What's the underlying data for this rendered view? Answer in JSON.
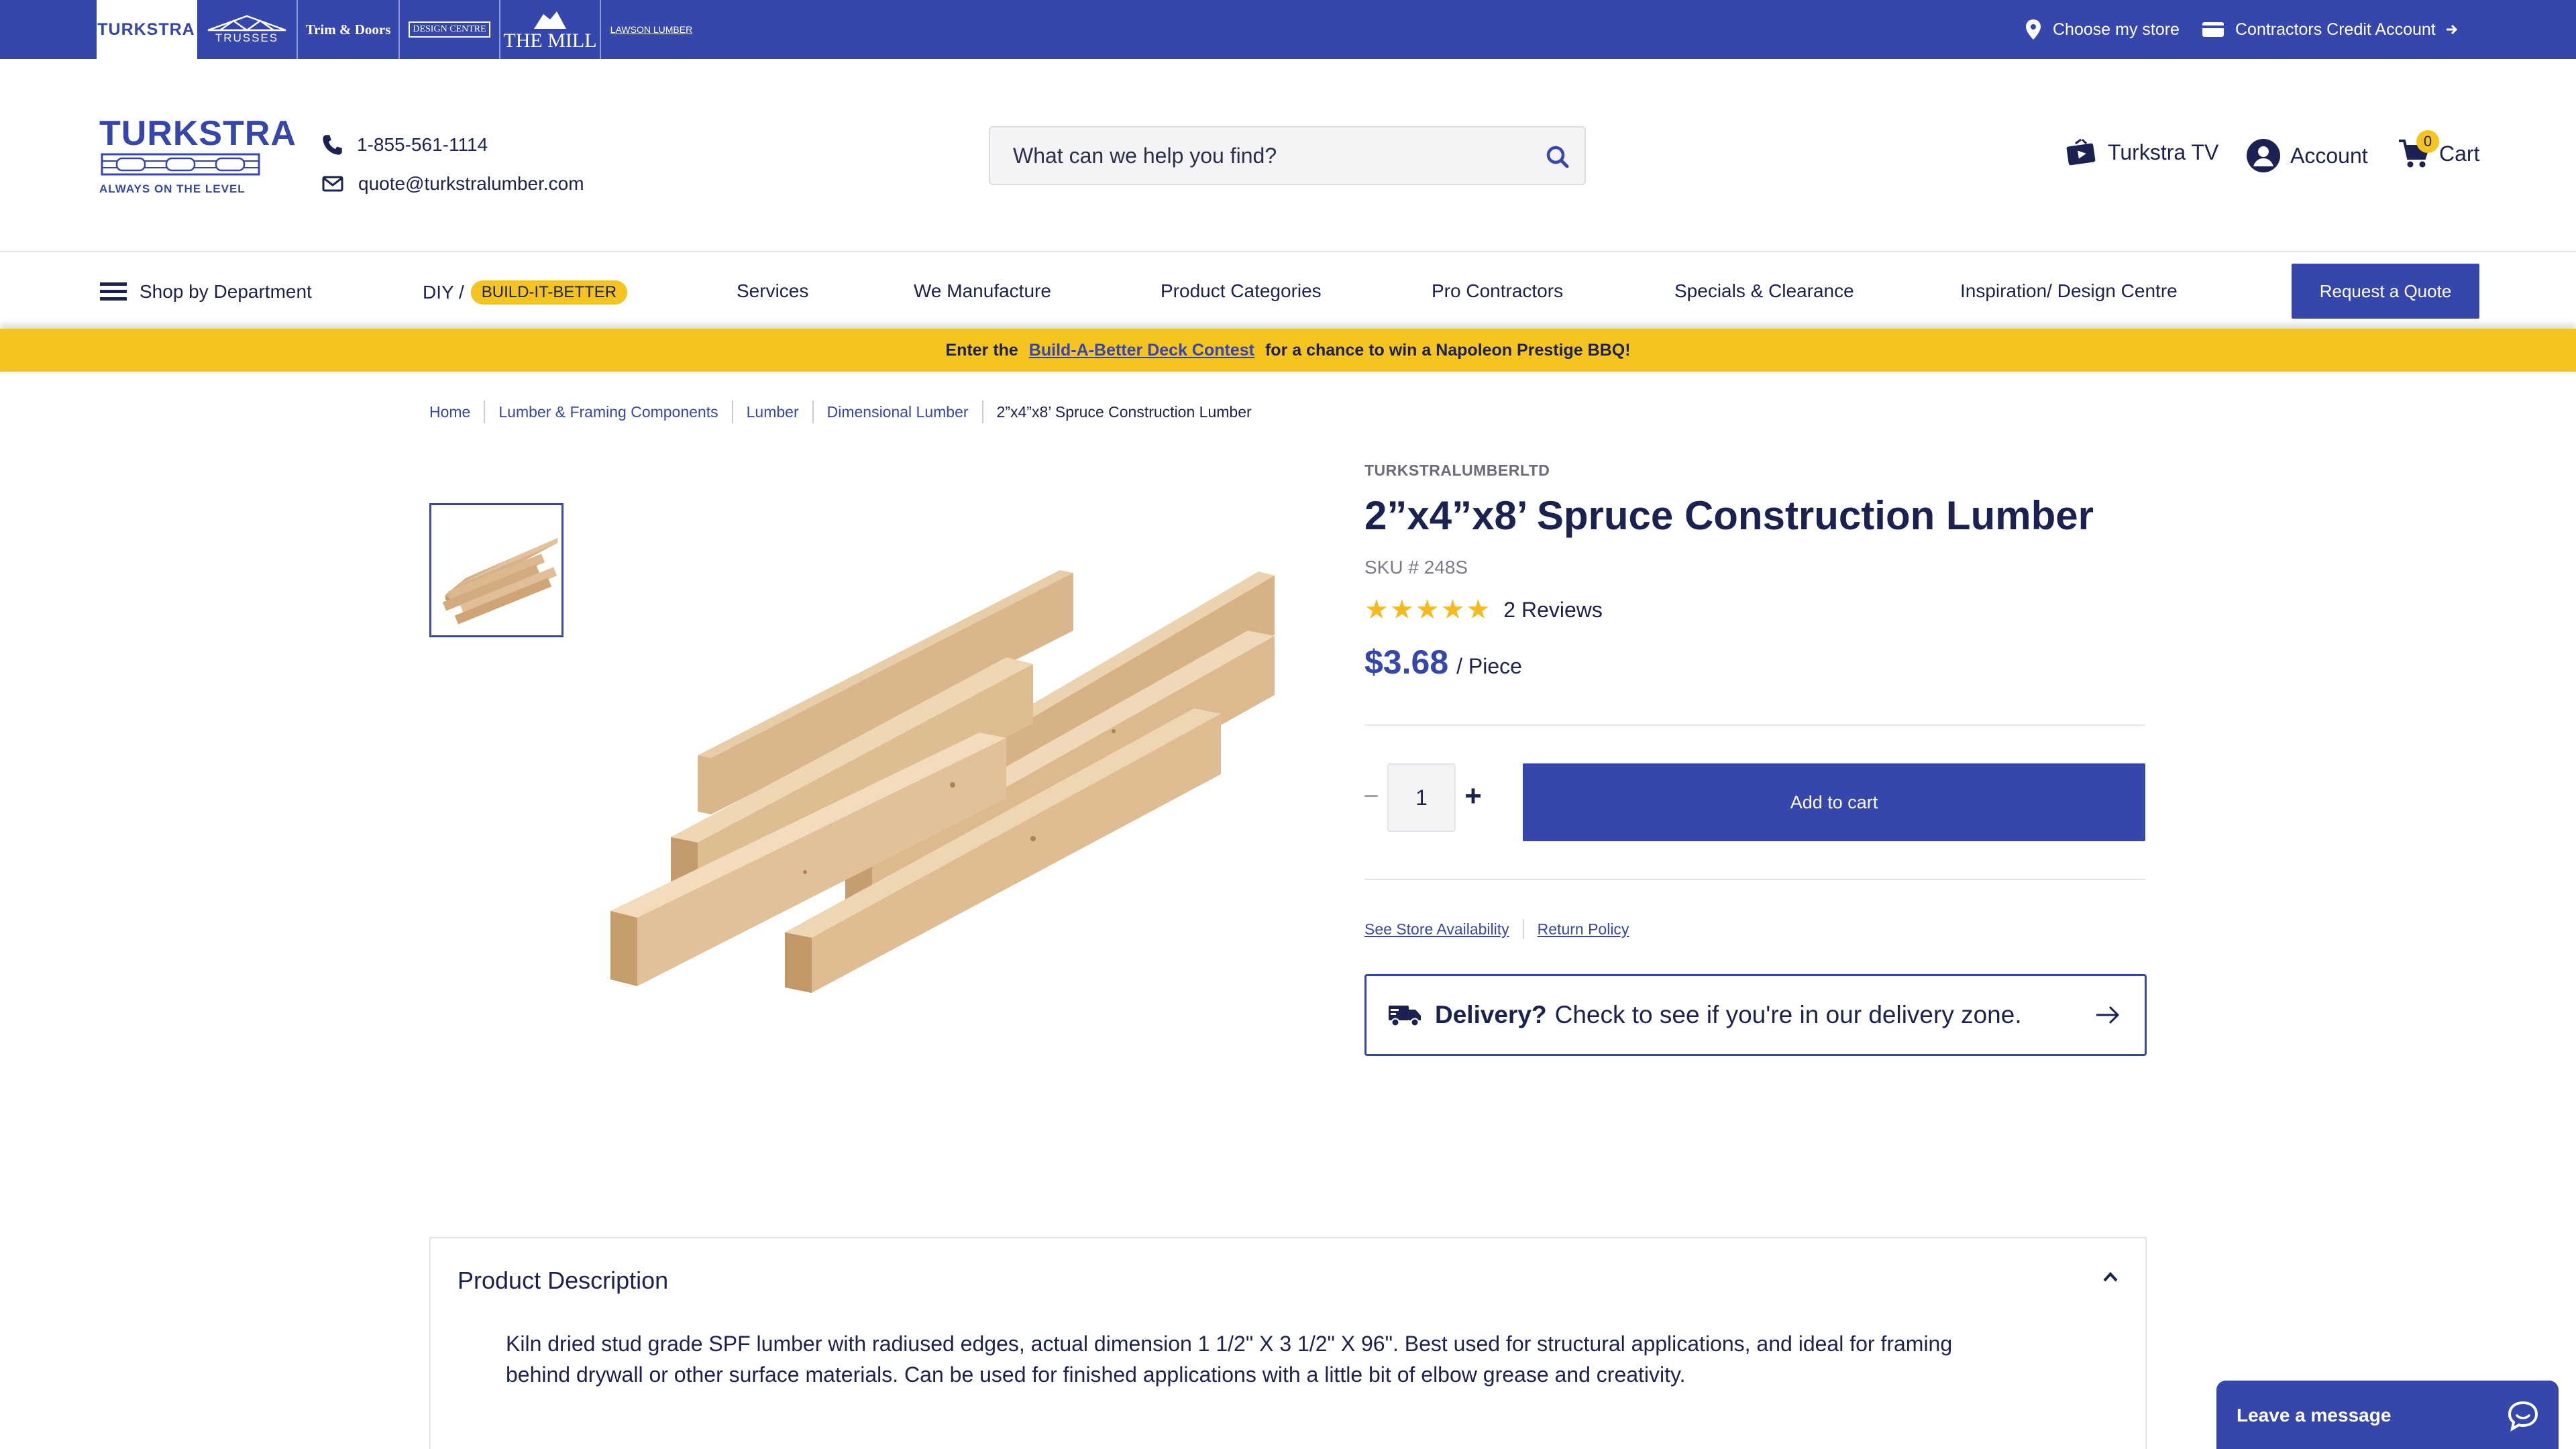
{
  "brand_bar": {
    "brands": [
      "TURKSTRA",
      "TRUSSES",
      "Trim & Doors",
      "DESIGN CENTRE",
      "THE MILL",
      "LAWSON LUMBER"
    ],
    "choose_store": "Choose my store",
    "credit_account": "Contractors Credit Account"
  },
  "header": {
    "logo_word": "TURKSTRA",
    "logo_tagline": "ALWAYS ON THE LEVEL",
    "phone": "1-855-561-1114",
    "email": "quote@turkstralumber.com",
    "search_placeholder": "What can we help you find?",
    "tv_label": "Turkstra TV",
    "account_label": "Account",
    "cart_label": "Cart",
    "cart_count": "0"
  },
  "nav": {
    "shop_by_department": "Shop by Department",
    "diy": "DIY /",
    "diy_pill": "BUILD-IT-BETTER",
    "services": "Services",
    "we_manufacture": "We Manufacture",
    "product_categories": "Product Categories",
    "pro_contractors": "Pro Contractors",
    "specials": "Specials & Clearance",
    "inspiration": "Inspiration/ Design Centre",
    "request_quote": "Request a Quote"
  },
  "promo": {
    "before": "Enter the",
    "link": "Build-A-Better Deck Contest",
    "after": "for a chance to win a Napoleon Prestige BBQ!"
  },
  "breadcrumb": [
    "Home",
    "Lumber & Framing Components",
    "Lumber",
    "Dimensional Lumber",
    "2\"x4\"x8' Spruce Construction Lumber"
  ],
  "product": {
    "brand": "TURKSTRALUMBERLTD",
    "title": "2”x4”x8’ Spruce Construction Lumber",
    "sku": "SKU # 248S",
    "stars": "★★★★★",
    "rating": 5,
    "reviews": "2 Reviews",
    "price": "$3.68",
    "unit": "/ Piece",
    "quantity": "1",
    "add_to_cart": "Add to cart",
    "store_availability": "See Store Availability",
    "return_policy": "Return Policy",
    "delivery_bold": "Delivery?",
    "delivery_text": "Check to see if you're in our delivery zone."
  },
  "description": {
    "title": "Product Description",
    "text": "Kiln dried stud grade SPF lumber with radiused edges, actual dimension 1 1/2\" X 3 1/2\" X 96\". Best used for structural applications, and ideal for framing behind drywall or other surface materials. Can be used for finished applications with a little bit of elbow grease and creativity."
  },
  "chat": {
    "label": "Leave a message"
  },
  "colors": {
    "brand_blue": "#3546ac",
    "navy_text": "#1b2150",
    "yellow": "#f6c41f",
    "star": "#f6b91f"
  },
  "icons": [
    "map-pin-icon",
    "credit-card-icon",
    "arrow-right-icon",
    "phone-icon",
    "mail-icon",
    "search-icon",
    "tv-icon",
    "account-icon",
    "cart-icon",
    "hamburger-icon",
    "delivery-truck-icon",
    "chevron-up-icon",
    "chat-bubble-icon"
  ]
}
